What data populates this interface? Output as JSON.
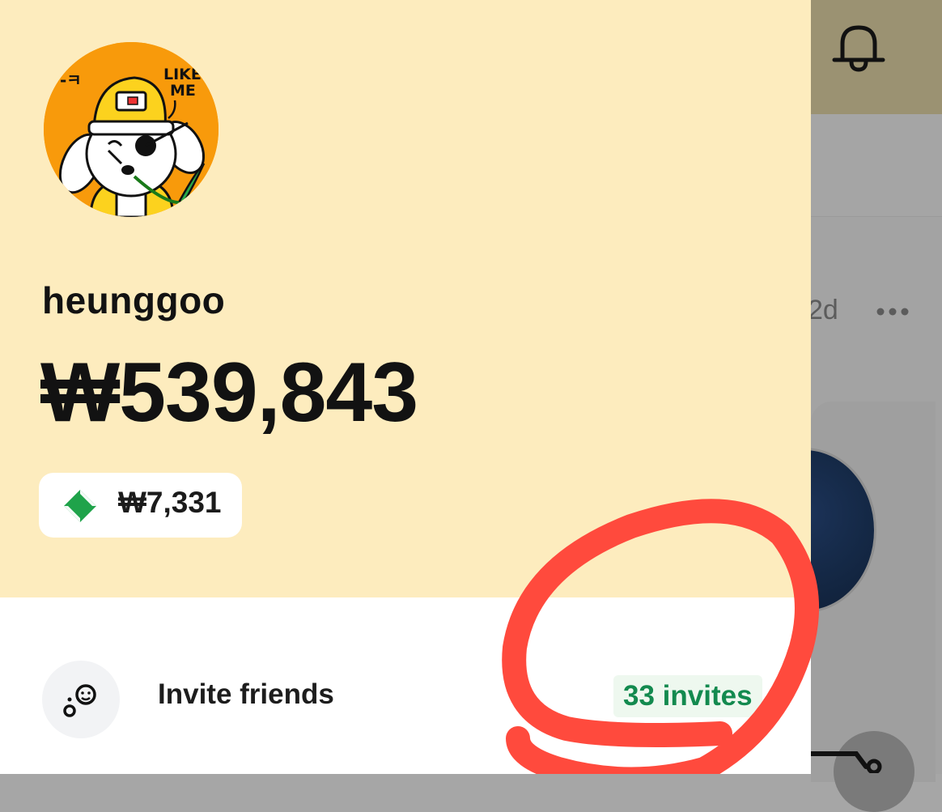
{
  "background": {
    "post_time": "2d",
    "more_icon": "more-horizontal-icon",
    "bell_icon": "bell-icon"
  },
  "drawer": {
    "username": "heunggoo",
    "balance": "₩539,843",
    "points": "₩7,331",
    "points_icon": "green-diamond-icon",
    "invite": {
      "label": "Invite friends",
      "count": "33 invites",
      "icon": "invite-friends-icon"
    }
  },
  "avatar": {
    "sticker_text": "LIKE ME"
  },
  "colors": {
    "header_bg": "#fdecbe",
    "avatar_bg": "#f89a0b",
    "accent_green": "#138a4f",
    "annotation_red": "#ff4a3d"
  }
}
